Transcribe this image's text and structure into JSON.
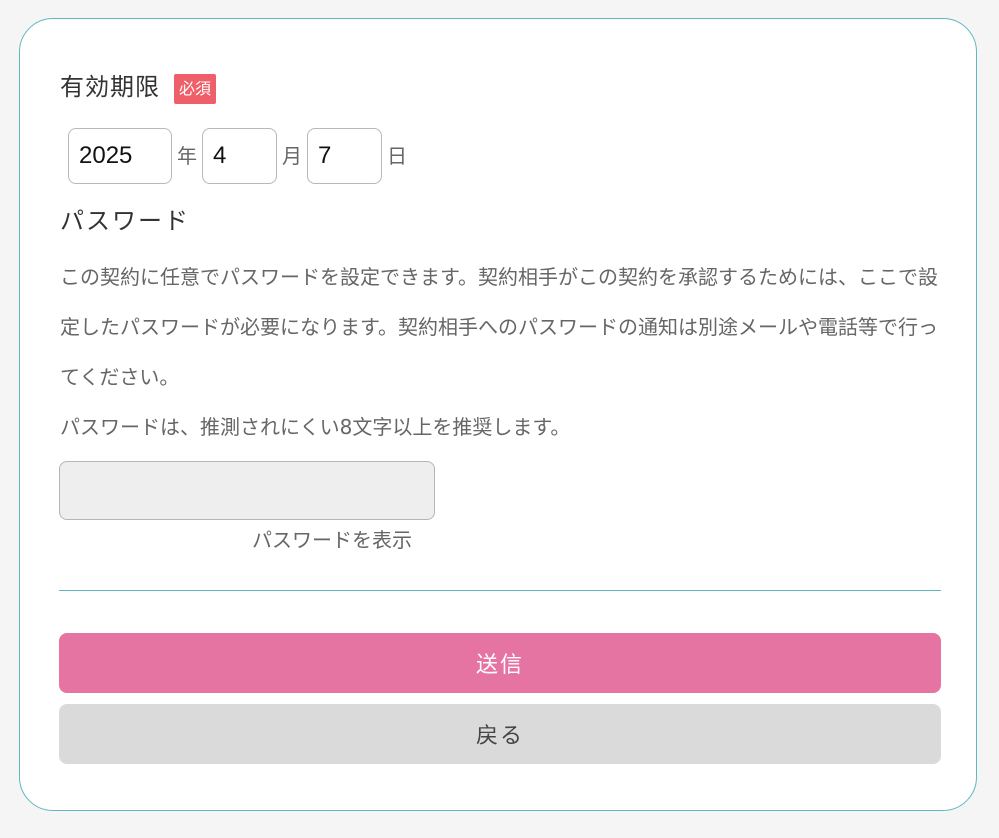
{
  "expiry": {
    "title": "有効期限",
    "required_badge": "必須",
    "year": "2025",
    "year_unit": "年",
    "month": "4",
    "month_unit": "月",
    "day": "7",
    "day_unit": "日"
  },
  "password": {
    "title": "パスワード",
    "description": [
      "この契約に任意でパスワードを設定できます。契約相手がこの契約を承認するためには、ここで設定したパスワードが必要になります。契約相手へのパスワードの通知は別途メールや電話等で行ってください。",
      "パスワードは、推測されにくい8文字以上を推奨します。"
    ],
    "value": "",
    "show_label": "パスワードを表示"
  },
  "actions": {
    "submit_label": "送信",
    "back_label": "戻る"
  },
  "colors": {
    "accent_border": "#5fb8bf",
    "required": "#ef5f6a",
    "submit": "#e574a3",
    "back": "#dadada"
  }
}
